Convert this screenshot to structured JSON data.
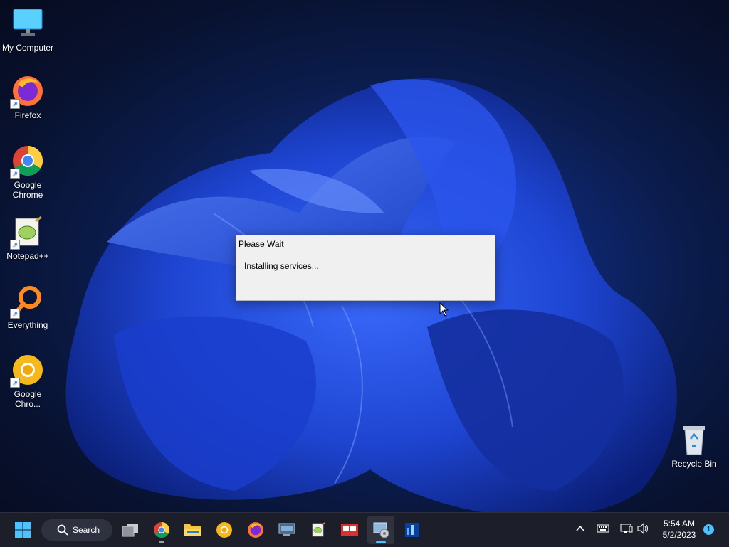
{
  "desktop": {
    "icons": [
      {
        "label": "My Computer"
      },
      {
        "label": "Firefox"
      },
      {
        "label": "Google Chrome"
      },
      {
        "label": "Notepad++"
      },
      {
        "label": "Everything"
      },
      {
        "label": "Google Chro..."
      },
      {
        "label": "Recycle Bin"
      }
    ]
  },
  "dialog": {
    "title": "Please Wait",
    "message": "Installing services..."
  },
  "taskbar": {
    "search_label": "Search",
    "apps": [
      "task-view",
      "chrome",
      "file-explorer",
      "chrome-canary",
      "firefox",
      "remote-desktop",
      "notepad-plus-plus",
      "presentation-app",
      "setup-installer",
      "network-tool"
    ],
    "tray": {
      "time": "5:54 AM",
      "date": "5/2/2023",
      "notification_count": "1"
    }
  },
  "colors": {
    "taskbar_bg": "#1c1f2a",
    "accent": "#4cc2ff",
    "dialog_bg": "#f0f0f0"
  }
}
